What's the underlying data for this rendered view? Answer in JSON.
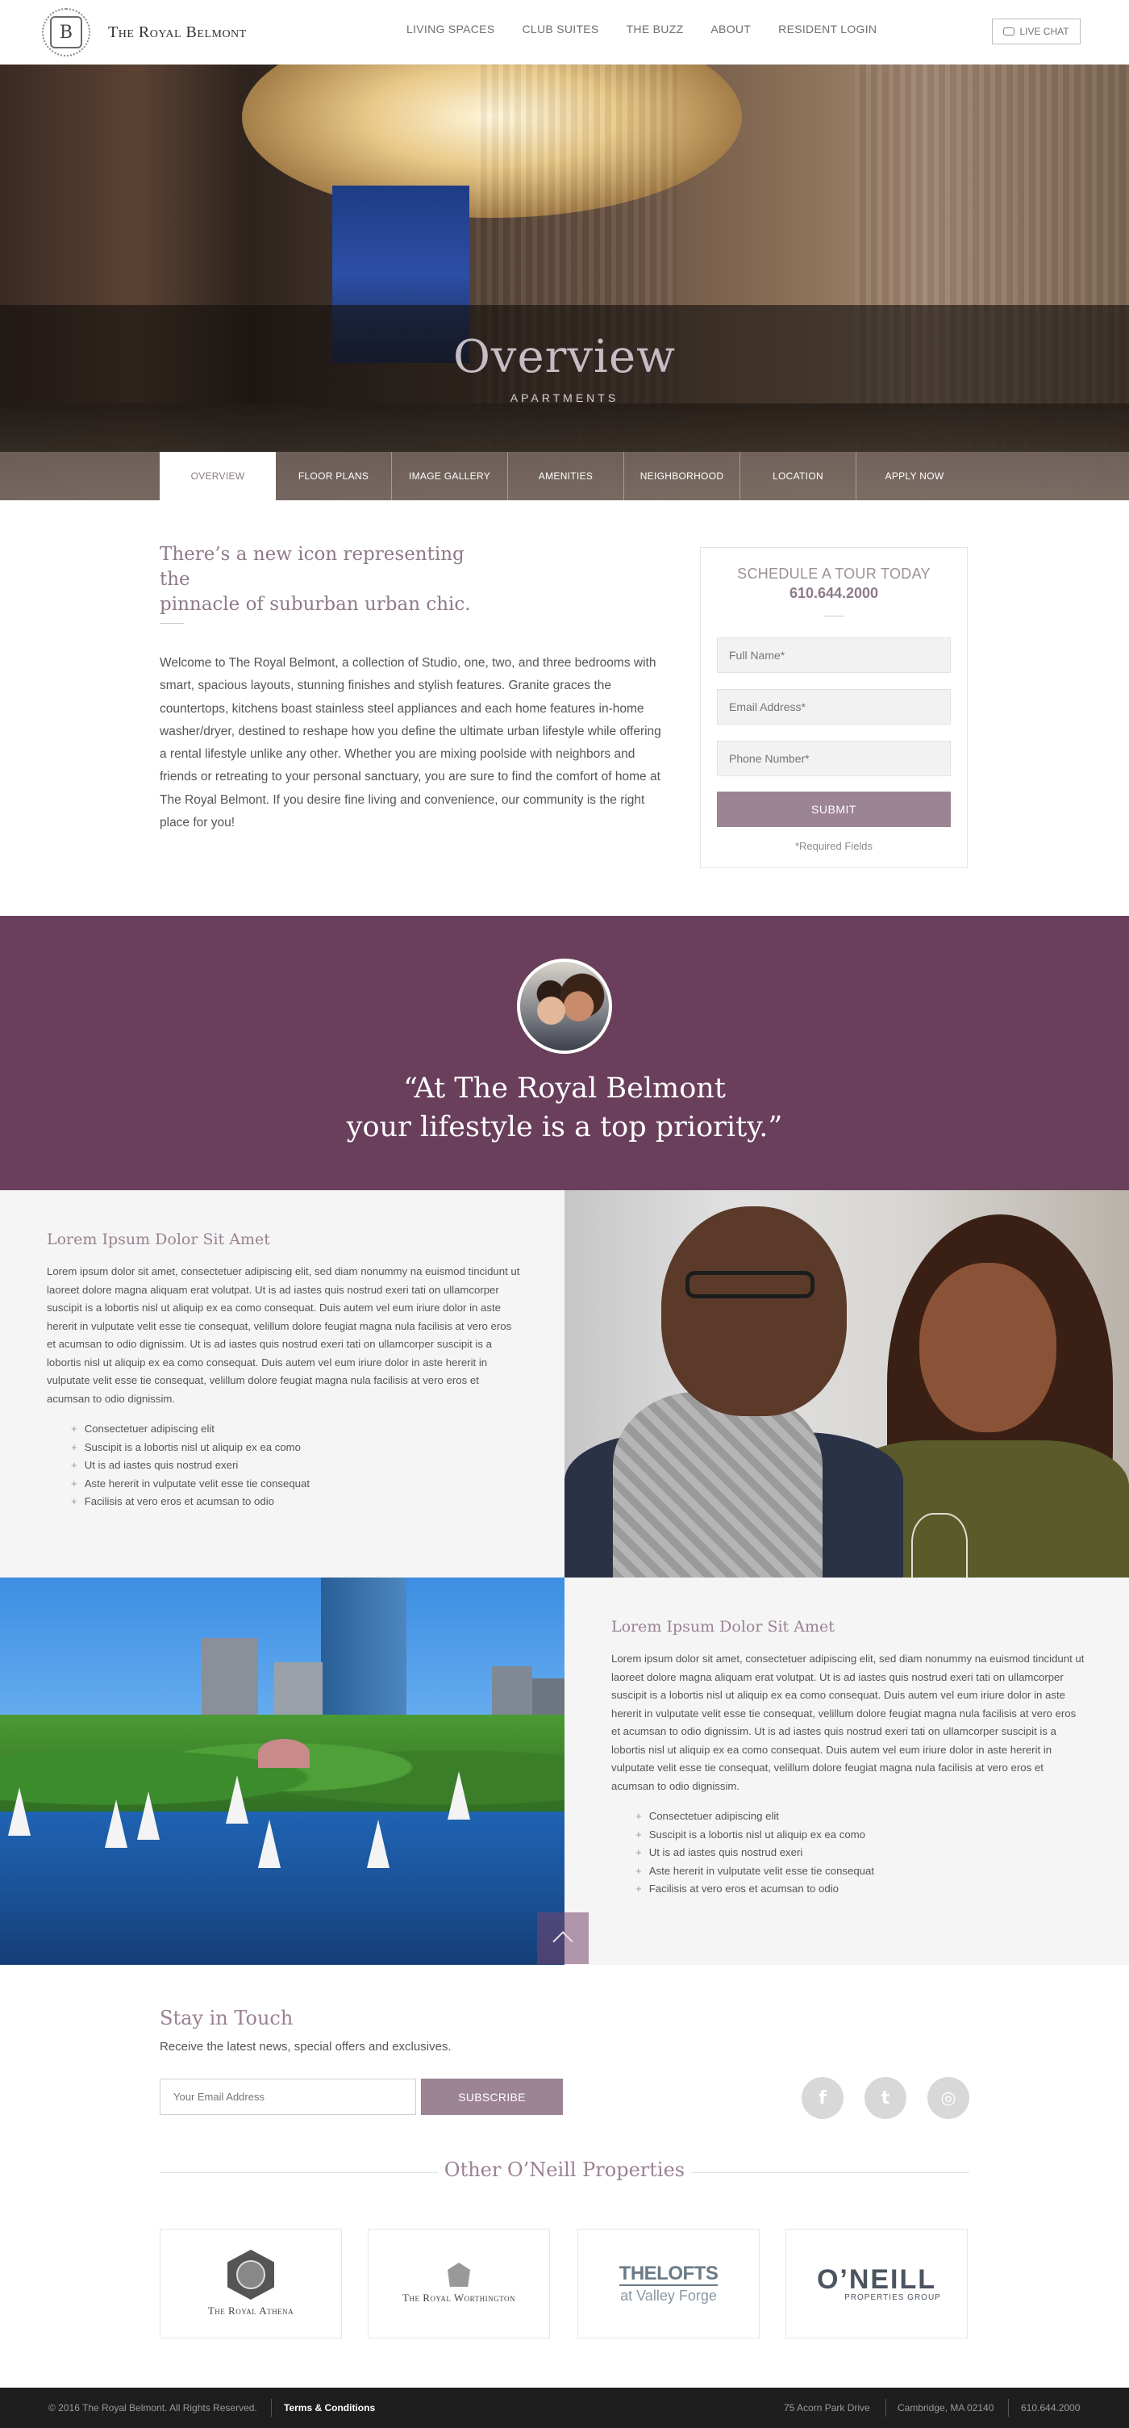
{
  "header": {
    "logo_letter": "B",
    "logo_text": "The Royal Belmont",
    "nav": [
      "LIVING SPACES",
      "CLUB SUITES",
      "THE BUZZ",
      "ABOUT",
      "RESIDENT LOGIN"
    ],
    "live_chat": "LIVE CHAT"
  },
  "hero": {
    "title": "Overview",
    "subtitle": "APARTMENTS",
    "tabs": [
      "OVERVIEW",
      "FLOOR PLANS",
      "IMAGE GALLERY",
      "AMENITIES",
      "NEIGHBORHOOD",
      "LOCATION",
      "APPLY NOW"
    ],
    "active_tab": "OVERVIEW"
  },
  "intro": {
    "heading_line1": "There’s a new icon representing the",
    "heading_line2": "pinnacle of suburban urban chic.",
    "body": "Welcome to The Royal Belmont, a collection of Studio, one, two, and three bedrooms with smart, spacious layouts, stunning finishes and stylish features. Granite graces the countertops, kitchens boast stainless steel appliances and each home features in-home washer/dryer, destined to reshape how you define the ultimate urban lifestyle while offering a rental lifestyle unlike any other. Whether you are mixing poolside with neighbors and friends or retreating to your personal sanctuary, you are sure to find the comfort of home at The Royal Belmont. If you desire fine living and convenience, our community is the right place for you!"
  },
  "tour": {
    "title": "SCHEDULE A TOUR TODAY",
    "phone": "610.644.2000",
    "fields": {
      "name_placeholder": "Full Name*",
      "email_placeholder": "Email Address*",
      "phone_placeholder": "Phone Number*"
    },
    "submit": "SUBMIT",
    "required_note": "*Required Fields"
  },
  "quote": {
    "line1": "“At The Royal Belmont",
    "line2": "your lifestyle is a top priority.”"
  },
  "feature1": {
    "title": "Lorem Ipsum Dolor Sit Amet",
    "body": "Lorem ipsum dolor sit amet, consectetuer adipiscing elit, sed diam nonummy na euismod tincidunt ut laoreet dolore magna aliquam erat volutpat. Ut is ad iastes quis nostrud exeri tati on ullamcorper suscipit is a lobortis nisl ut aliquip ex ea como consequat. Duis autem vel eum iriure dolor in aste hererit in vulputate velit esse tie consequat, velillum dolore feugiat magna nula facilisis at vero eros et acumsan to odio dignissim. Ut is ad iastes quis nostrud exeri tati on ullamcorper suscipit is a lobortis nisl ut aliquip ex ea como consequat. Duis autem vel eum iriure dolor in aste hererit in vulputate velit esse tie consequat, velillum dolore feugiat magna nula facilisis at vero eros et acumsan to odio dignissim.",
    "list": [
      "Consectetuer adipiscing elit",
      "Suscipit is a lobortis nisl ut aliquip ex ea como",
      "Ut is ad iastes quis nostrud exeri",
      "Aste hererit in vulputate velit esse tie consequat",
      "Facilisis at vero eros et acumsan to odio"
    ]
  },
  "feature2": {
    "title": "Lorem Ipsum Dolor Sit Amet",
    "body": "Lorem ipsum dolor sit amet, consectetuer adipiscing elit, sed diam nonummy na euismod tincidunt ut laoreet dolore magna aliquam erat volutpat. Ut is ad iastes quis nostrud exeri tati on ullamcorper suscipit is a lobortis nisl ut aliquip ex ea como consequat. Duis autem vel eum iriure dolor in aste hererit in vulputate velit esse tie consequat, velillum dolore feugiat magna nula facilisis at vero eros et acumsan to odio dignissim. Ut is ad iastes quis nostrud exeri tati on ullamcorper suscipit is a lobortis nisl ut aliquip ex ea como consequat. Duis autem vel eum iriure dolor in aste hererit in vulputate velit esse tie consequat, velillum dolore feugiat magna nula facilisis at vero eros et acumsan to odio dignissim.",
    "list": [
      "Consectetuer adipiscing elit",
      "Suscipit is a lobortis nisl ut aliquip ex ea como",
      "Ut is ad iastes quis nostrud exeri",
      "Aste hererit in vulputate velit esse tie consequat",
      "Facilisis at vero eros et acumsan to odio"
    ]
  },
  "newsletter": {
    "title": "Stay in Touch",
    "subtitle": "Receive the latest news, special offers and exclusives.",
    "email_placeholder": "Your Email Address",
    "button": "SUBSCRIBE",
    "social": {
      "facebook": "f",
      "twitter": "t",
      "instagram": "◎"
    }
  },
  "properties": {
    "title": "Other O’Neill Properties",
    "items": {
      "athena": "The Royal Athena",
      "worthington": "The Royal Worthington",
      "lofts_main": "THELOFTS",
      "lofts_sub": "at Valley Forge",
      "oneill_main": "O’NEILL",
      "oneill_sub": "PROPERTIES GROUP"
    }
  },
  "footer": {
    "copyright": "© 2016 The Royal Belmont. All Rights Reserved.",
    "terms": "Terms & Conditions",
    "address": "75 Acorn Park Drive",
    "city": "Cambridge, MA 02140",
    "phone": "610.644.2000"
  },
  "colors": {
    "accent": "#9c8495",
    "quote_band": "#6a3f5b",
    "heading": "#9a8293",
    "footer_bg": "#1e1e1e"
  },
  "icons": [
    "chat-icon",
    "arrow-up-icon",
    "facebook-icon",
    "twitter-icon",
    "instagram-icon"
  ]
}
